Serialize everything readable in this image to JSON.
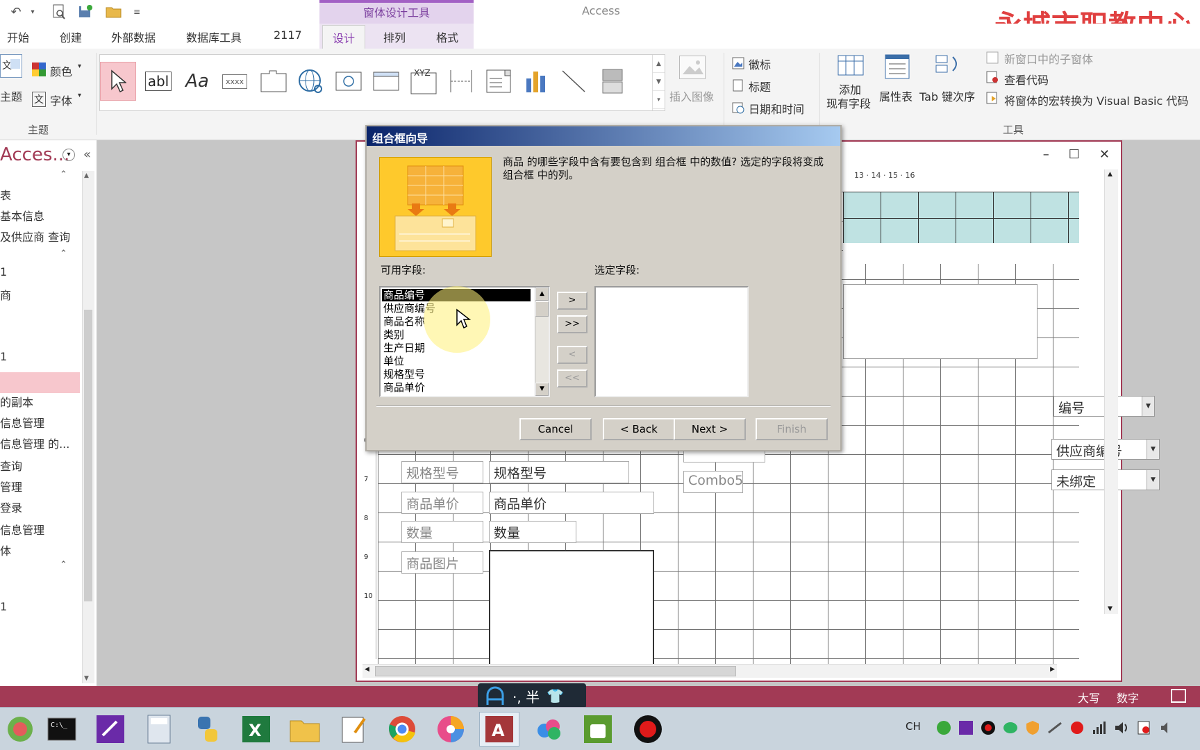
{
  "app": {
    "title": "Access",
    "context_header": "窗体设计工具",
    "watermark": "永城市职教中心"
  },
  "tabs": [
    "开始",
    "创建",
    "外部数据",
    "数据库工具",
    "2117",
    "设计",
    "排列",
    "格式"
  ],
  "active_tab": "设计",
  "ribbon": {
    "theme_group": {
      "theme_label": "主题",
      "colors_label": "颜色",
      "fonts_label": "字体",
      "group_label": "主题"
    },
    "insert_image_label": "插入图像",
    "header_footer": {
      "logo": "徽标",
      "title": "标题",
      "datetime": "日期和时间"
    },
    "tools": {
      "add_existing_fields_line1": "添加",
      "add_existing_fields_line2": "现有字段",
      "property_sheet": "属性表",
      "tab_order": "Tab 键次序",
      "subform_new_window": "新窗口中的子窗体",
      "view_code": "查看代码",
      "convert_macros": "将窗体的宏转换为 Visual Basic 代码",
      "group_label": "工具"
    },
    "gallery_labels": {
      "textbox": "abl",
      "label": "Aa",
      "button": "xxxx",
      "option_group": "XYZ"
    }
  },
  "nav_pane": {
    "title": "Acces...",
    "items": [
      "表",
      "基本信息",
      "及供应商 查询",
      "1",
      "商",
      "1",
      "",
      "的副本",
      "信息管理",
      "信息管理 的...",
      "查询",
      "管理",
      "登录",
      "信息管理",
      "体",
      "1"
    ],
    "selected_index": 6
  },
  "form": {
    "ruler_marks": "13 · 14 · 15 · 16",
    "vruler_marks": [
      "6",
      "7",
      "8",
      "9",
      "10"
    ],
    "fields": [
      {
        "label": "规格型号",
        "text": "规格型号"
      },
      {
        "label": "商品单价",
        "text": "商品单价"
      },
      {
        "label": "数量",
        "text": "数量"
      },
      {
        "label": "商品图片",
        "text": ""
      }
    ],
    "combo_labels": [
      "Combo5"
    ],
    "combos": [
      "编号",
      "供应商编号",
      "未绑定"
    ]
  },
  "dialog": {
    "title": "组合框向导",
    "description": "商品 的哪些字段中含有要包含到 组合框 中的数值? 选定的字段将变成 组合框 中的列。",
    "available_label": "可用字段:",
    "selected_label": "选定字段:",
    "available_fields": [
      "商品编号",
      "供应商编号",
      "商品名称",
      "类别",
      "生产日期",
      "单位",
      "规格型号",
      "商品单价"
    ],
    "selected_fields": [],
    "move_buttons": [
      ">",
      ">>",
      "<",
      "<<"
    ],
    "buttons": {
      "cancel": "Cancel",
      "back": "< Back",
      "next": "Next >",
      "finish": "Finish"
    }
  },
  "status_bar": {
    "caps": "大写",
    "num": "数字"
  },
  "ime": {
    "text": "·, 半"
  },
  "taskbar": {
    "lang": "CH"
  },
  "colors": {
    "accent": "#a23a55",
    "context_tab": "#a260c4",
    "dialog_title_start": "#0a246a",
    "dialog_bg": "#d4d0c8"
  }
}
